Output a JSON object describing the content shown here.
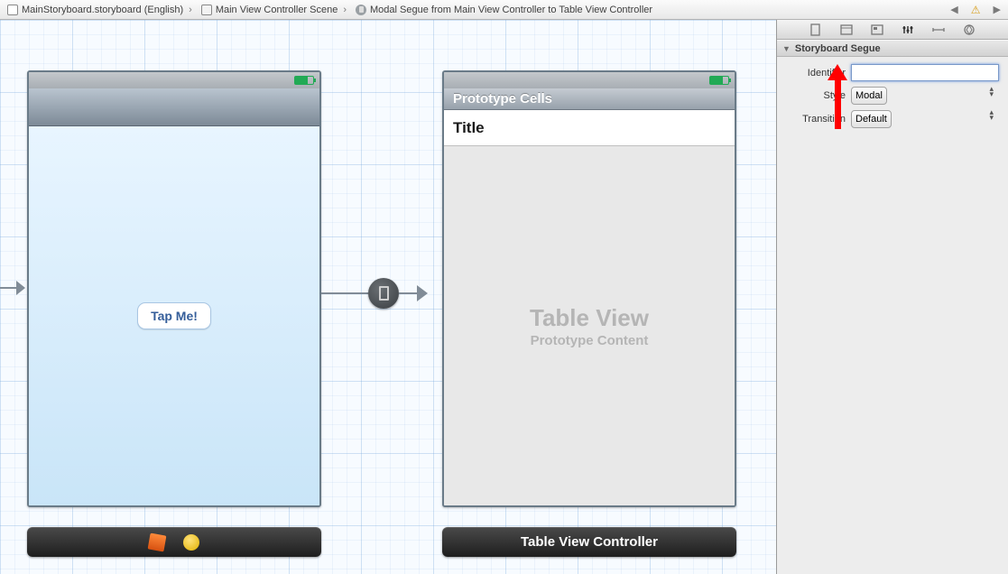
{
  "jumpbar": {
    "file": "MainStoryboard.storyboard (English)",
    "scene": "Main View Controller Scene",
    "segue": "Modal Segue from Main View Controller to Table View Controller"
  },
  "scene_a": {
    "button_label": "Tap Me!"
  },
  "scene_b": {
    "proto_header": "Prototype Cells",
    "cell_title": "Title",
    "placeholder_big": "Table View",
    "placeholder_small": "Prototype Content",
    "dock_label": "Table View Controller"
  },
  "inspector": {
    "section_title": "Storyboard Segue",
    "identifier_label": "Identifier",
    "identifier_value": "",
    "style_label": "Style",
    "style_value": "Modal",
    "transition_label": "Transition",
    "transition_value": "Default"
  }
}
